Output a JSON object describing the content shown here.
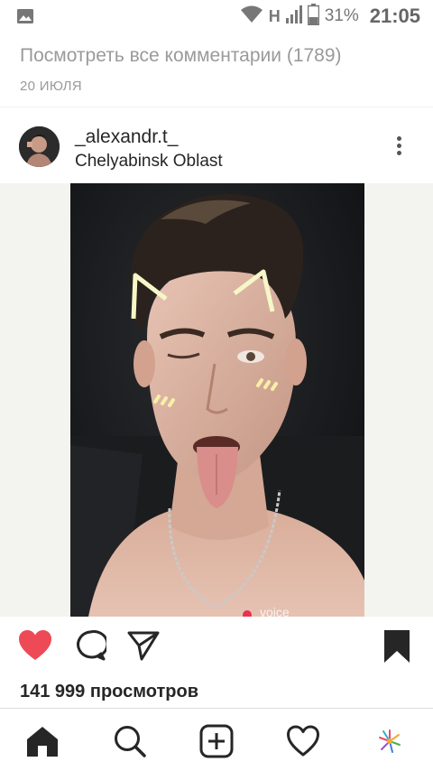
{
  "status_bar": {
    "network": "H",
    "battery": "31%",
    "time": "21:05",
    "icons": [
      "image-icon",
      "wifi-icon",
      "signal-icon",
      "battery-icon"
    ]
  },
  "previous": {
    "comments_link": "Посмотреть все комментарии (1789)",
    "date": "20 ИЮЛЯ"
  },
  "post": {
    "username": "_alexandr.t_",
    "location": "Chelyabinsk Oblast",
    "liked": true,
    "views_count": "141 999",
    "views_label": "просмотров",
    "watermark": "voice"
  },
  "actions": {
    "icons": [
      "heart-icon",
      "comment-icon",
      "share-icon",
      "bookmark-icon"
    ],
    "like_color": "#ed4956"
  },
  "nav": {
    "items": [
      "home-icon",
      "search-icon",
      "add-post-icon",
      "activity-icon",
      "profile-icon"
    ]
  },
  "colors": {
    "text": "#262626",
    "muted": "#9a9a9a",
    "like": "#ed4956"
  }
}
